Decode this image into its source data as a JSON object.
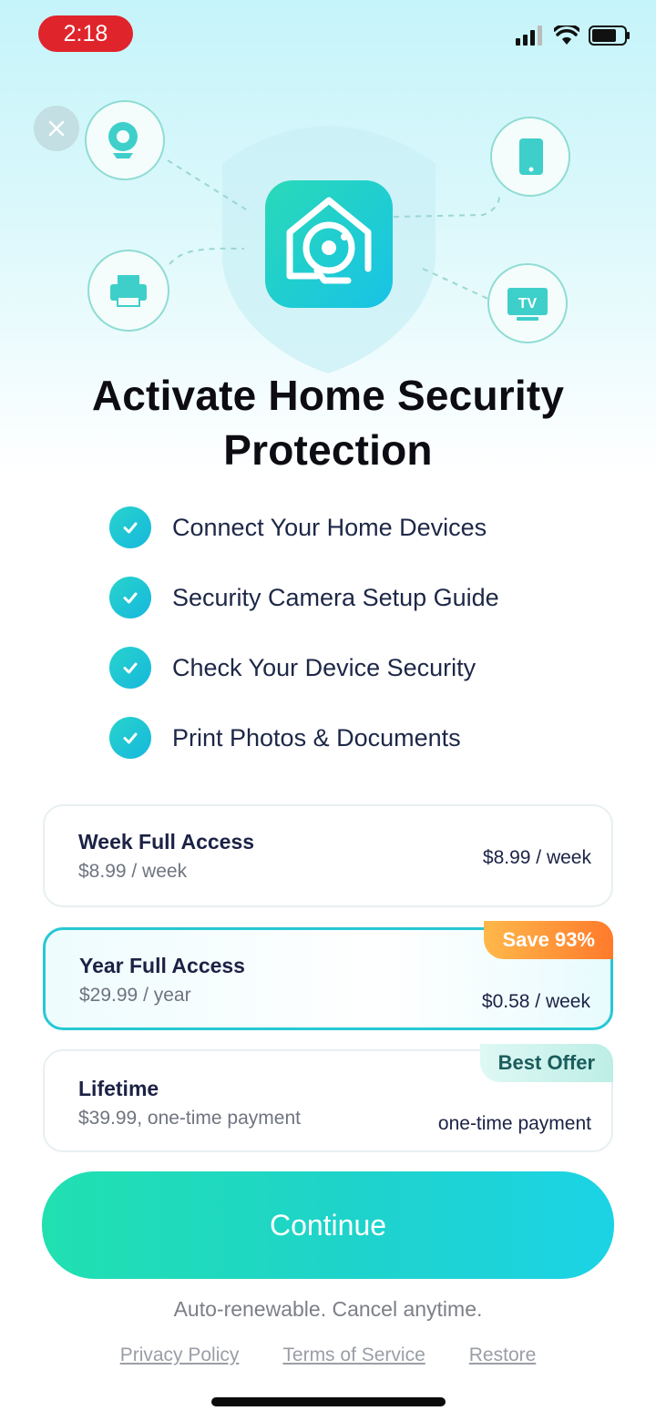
{
  "status": {
    "time": "2:18"
  },
  "hero": {
    "title_line1": "Activate Home Security",
    "title_line2": "Protection",
    "device_icons": [
      "webcam-icon",
      "printer-icon",
      "phone-icon",
      "tv-icon"
    ],
    "tv_label": "TV"
  },
  "features": [
    {
      "label": "Connect Your Home Devices"
    },
    {
      "label": "Security Camera Setup Guide"
    },
    {
      "label": "Check Your Device Security"
    },
    {
      "label": "Print Photos & Documents"
    }
  ],
  "plans": {
    "week": {
      "name": "Week Full Access",
      "sub": "$8.99 / week",
      "right": "$8.99 / week"
    },
    "year": {
      "name": "Year Full Access",
      "sub": "$29.99 / year",
      "right": "$0.58 / week",
      "badge": "Save 93%",
      "selected": true
    },
    "lifetime": {
      "name": "Lifetime",
      "sub": "$39.99, one-time payment",
      "right": "one-time payment",
      "badge": "Best Offer"
    }
  },
  "cta": {
    "label": "Continue"
  },
  "note": "Auto-renewable. Cancel anytime.",
  "links": {
    "privacy": "Privacy Policy",
    "terms": "Terms of Service",
    "restore": "Restore"
  },
  "colors": {
    "accent": "#1ed3cb",
    "selected_border": "#26c8d3",
    "save_badge": "#ff7a2b",
    "status_pill": "#e0242b"
  }
}
